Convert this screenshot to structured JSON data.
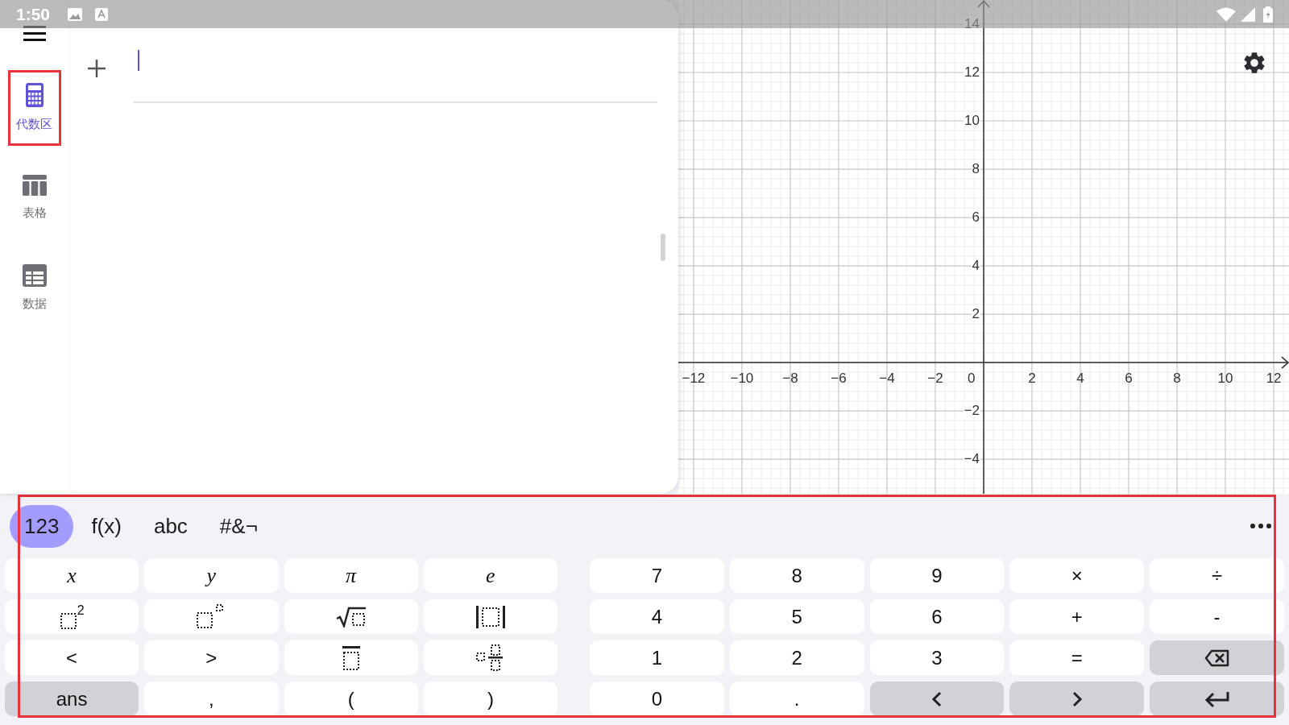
{
  "status_bar": {
    "time": "1:50"
  },
  "sidebar": {
    "items": [
      {
        "label": "代数区",
        "kind": "algebra",
        "selected": true,
        "highlighted": true
      },
      {
        "label": "表格",
        "kind": "table",
        "selected": false,
        "highlighted": false
      },
      {
        "label": "数据",
        "kind": "data",
        "selected": false,
        "highlighted": false
      }
    ]
  },
  "algebra": {
    "input": {
      "focused": true
    }
  },
  "graph": {
    "origin_label": "0",
    "chart_data": {
      "type": "line",
      "grid": true,
      "xlim": [
        -12.63,
        12.63
      ],
      "ylim": [
        -5.43,
        15
      ],
      "xticks": [
        {
          "value": -12,
          "label": "−12"
        },
        {
          "value": -10,
          "label": "−10"
        },
        {
          "value": -8,
          "label": "−8"
        },
        {
          "value": -6,
          "label": "−6"
        },
        {
          "value": -4,
          "label": "−4"
        },
        {
          "value": -2,
          "label": "−2"
        },
        {
          "value": 2,
          "label": "2"
        },
        {
          "value": 4,
          "label": "4"
        },
        {
          "value": 6,
          "label": "6"
        },
        {
          "value": 8,
          "label": "8"
        },
        {
          "value": 10,
          "label": "10"
        },
        {
          "value": 12,
          "label": "12"
        }
      ],
      "yticks": [
        {
          "value": -4,
          "label": "−4"
        },
        {
          "value": -2,
          "label": "−2"
        },
        {
          "value": 2,
          "label": "2"
        },
        {
          "value": 4,
          "label": "4"
        },
        {
          "value": 6,
          "label": "6"
        },
        {
          "value": 8,
          "label": "8"
        },
        {
          "value": 10,
          "label": "10"
        },
        {
          "value": 12,
          "label": "12"
        },
        {
          "value": 14,
          "label": "14"
        }
      ]
    }
  },
  "keyboard": {
    "highlighted": true,
    "tabs": [
      {
        "label": "123",
        "selected": true
      },
      {
        "label": "f(x)",
        "selected": false
      },
      {
        "label": "abc",
        "selected": false
      },
      {
        "label": "#&¬",
        "selected": false
      }
    ],
    "left_keys": [
      {
        "kind": "var",
        "label": "x",
        "shaded": false
      },
      {
        "kind": "var",
        "label": "y",
        "shaded": false
      },
      {
        "kind": "var",
        "label": "π",
        "shaded": false
      },
      {
        "kind": "var",
        "label": "e",
        "shaded": false
      },
      {
        "kind": "squared",
        "label": "2",
        "shaded": false
      },
      {
        "kind": "power",
        "shaded": false
      },
      {
        "kind": "root",
        "shaded": false
      },
      {
        "kind": "absolute",
        "shaded": false
      },
      {
        "kind": "char",
        "label": "<",
        "shaded": false
      },
      {
        "kind": "char",
        "label": ">",
        "shaded": false
      },
      {
        "kind": "overline",
        "shaded": false
      },
      {
        "kind": "mixed",
        "shaded": false
      },
      {
        "kind": "char",
        "label": "ans",
        "shaded": true
      },
      {
        "kind": "char",
        "label": ",",
        "shaded": false
      },
      {
        "kind": "char",
        "label": "(",
        "shaded": false
      },
      {
        "kind": "char",
        "label": ")",
        "shaded": false
      }
    ],
    "right_keys": [
      {
        "kind": "char",
        "label": "7",
        "shaded": false
      },
      {
        "kind": "char",
        "label": "8",
        "shaded": false
      },
      {
        "kind": "char",
        "label": "9",
        "shaded": false
      },
      {
        "kind": "char",
        "label": "×",
        "shaded": false
      },
      {
        "kind": "char",
        "label": "÷",
        "shaded": false
      },
      {
        "kind": "char",
        "label": "4",
        "shaded": false
      },
      {
        "kind": "char",
        "label": "5",
        "shaded": false
      },
      {
        "kind": "char",
        "label": "6",
        "shaded": false
      },
      {
        "kind": "char",
        "label": "+",
        "shaded": false
      },
      {
        "kind": "char",
        "label": "-",
        "shaded": false
      },
      {
        "kind": "char",
        "label": "1",
        "shaded": false
      },
      {
        "kind": "char",
        "label": "2",
        "shaded": false
      },
      {
        "kind": "char",
        "label": "3",
        "shaded": false
      },
      {
        "kind": "char",
        "label": "=",
        "shaded": false
      },
      {
        "kind": "backspace",
        "shaded": true
      },
      {
        "kind": "char",
        "label": "0",
        "shaded": false
      },
      {
        "kind": "char",
        "label": ".",
        "shaded": false
      },
      {
        "kind": "left",
        "shaded": true
      },
      {
        "kind": "right",
        "shaded": true
      },
      {
        "kind": "enter",
        "shaded": true
      }
    ]
  }
}
